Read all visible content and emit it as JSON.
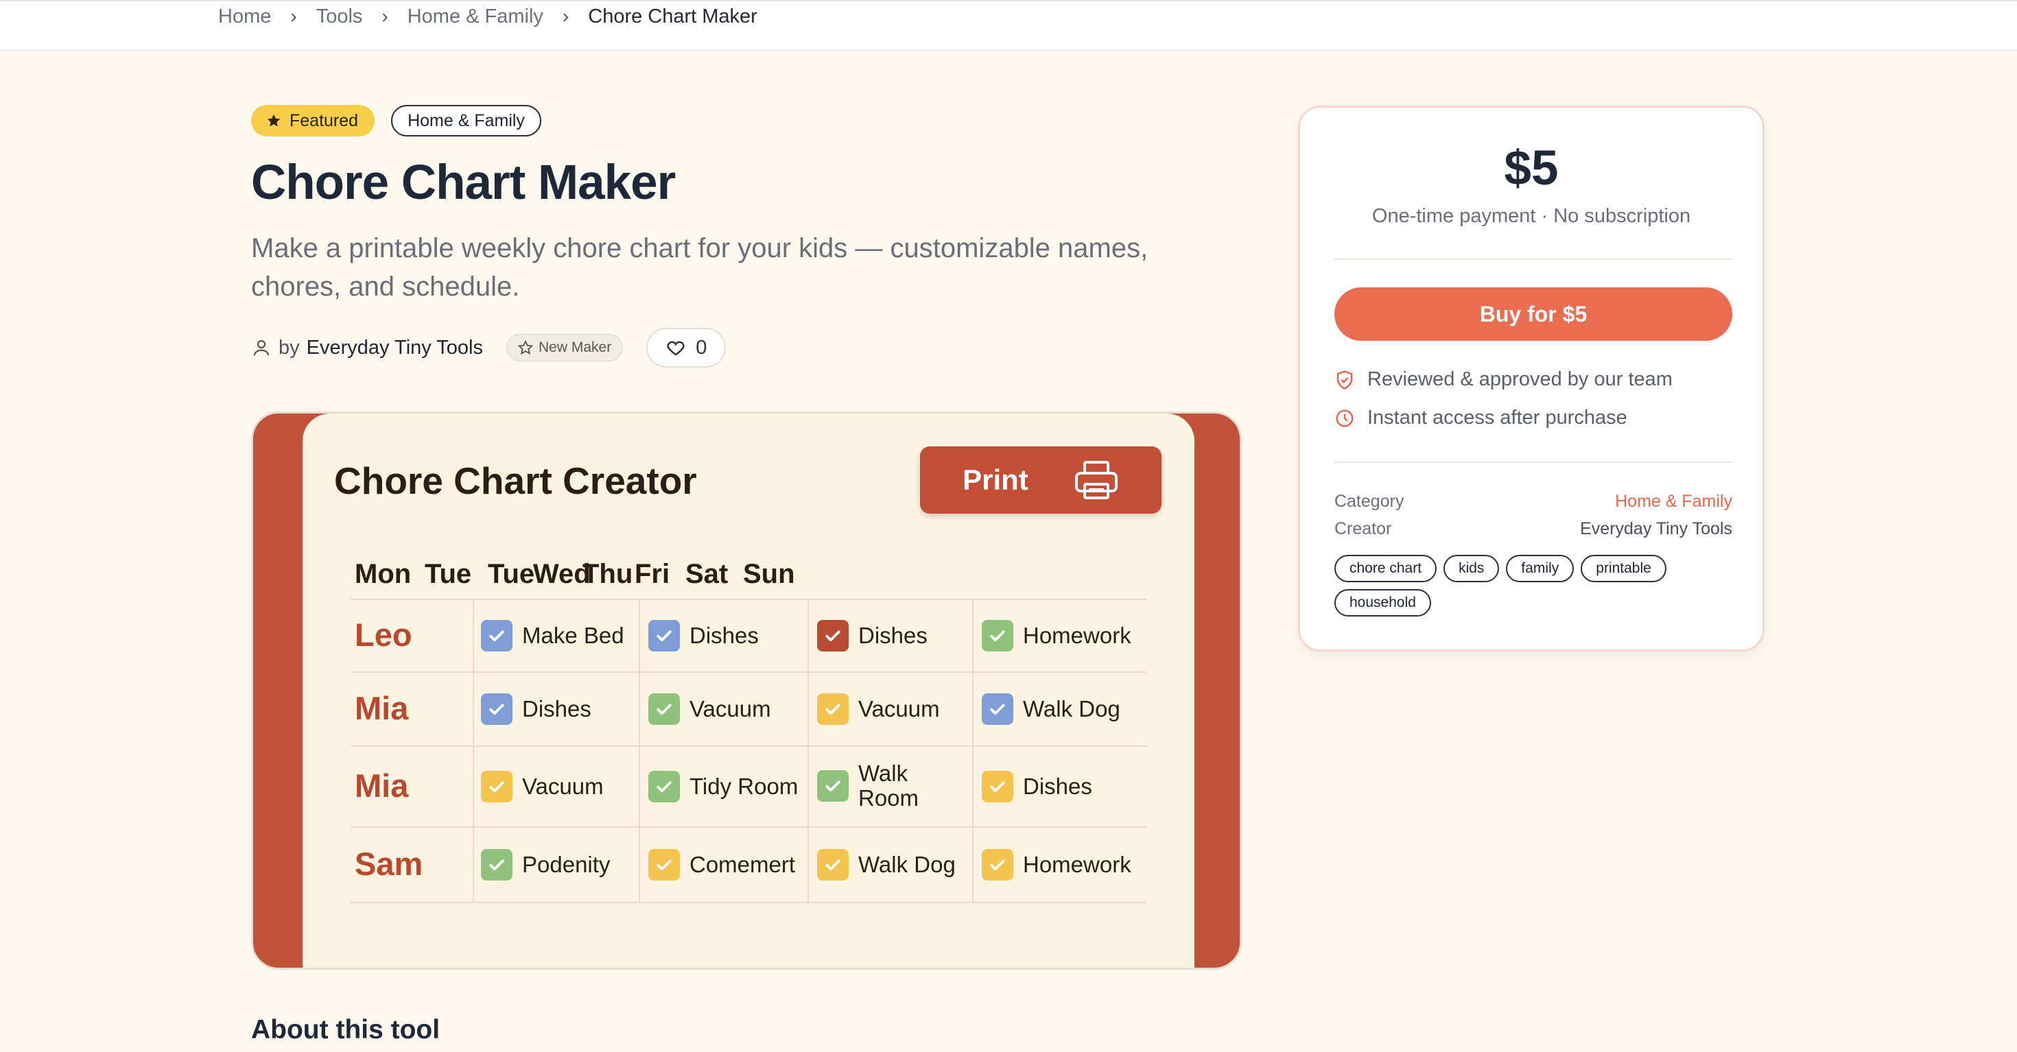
{
  "breadcrumb": [
    "Home",
    "Tools",
    "Home & Family",
    "Chore Chart Maker"
  ],
  "tags": {
    "featured": "Featured",
    "category": "Home & Family"
  },
  "title": "Chore Chart Maker",
  "subtitle": "Make a printable weekly chore chart for your kids — customizable names, chores, and schedule.",
  "meta": {
    "by": "by",
    "maker": "Everyday Tiny Tools",
    "new_maker": "New Maker",
    "likes": "0"
  },
  "preview": {
    "title": "Chore Chart Creator",
    "print": "Print",
    "days": [
      "Mon",
      "Tue",
      "Tue",
      "Wed",
      "Thu",
      "Fri",
      "Sat",
      "Sun"
    ],
    "rows": [
      {
        "name": "Leo",
        "cells": [
          {
            "text": "Make Bed",
            "color": "blue"
          },
          {
            "text": "Dishes",
            "color": "blue"
          },
          {
            "text": "Dishes",
            "color": "red"
          },
          {
            "text": "Homework",
            "color": "green"
          }
        ]
      },
      {
        "name": "Mia",
        "cells": [
          {
            "text": "Dishes",
            "color": "blue"
          },
          {
            "text": "Vacuum",
            "color": "green"
          },
          {
            "text": "Vacuum",
            "color": "yellow"
          },
          {
            "text": "Walk Dog",
            "color": "blue"
          }
        ]
      },
      {
        "name": "Mia",
        "cells": [
          {
            "text": "Vacuum",
            "color": "yellow"
          },
          {
            "text": "Tidy Room",
            "color": "green"
          },
          {
            "text": "Walk Room",
            "color": "green"
          },
          {
            "text": "Dishes",
            "color": "yellow"
          }
        ]
      },
      {
        "name": "Sam",
        "cells": [
          {
            "text": "Podenity",
            "color": "green"
          },
          {
            "text": "Comemert",
            "color": "yellow"
          },
          {
            "text": "Walk Dog",
            "color": "yellow"
          },
          {
            "text": "Homework",
            "color": "yellow"
          }
        ]
      }
    ]
  },
  "about": "About this tool",
  "pricing": {
    "price": "$5",
    "note": "One-time payment · No subscription",
    "buy": "Buy for $5",
    "assurances": [
      "Reviewed & approved by our team",
      "Instant access after purchase"
    ],
    "category_label": "Category",
    "category_value": "Home & Family",
    "creator_label": "Creator",
    "creator_value": "Everyday Tiny Tools",
    "chips": [
      "chore chart",
      "kids",
      "family",
      "printable",
      "household"
    ]
  },
  "colors": {
    "accent": "#e96d50",
    "featured": "#f7cf4a",
    "preview_bg": "#c0533a"
  }
}
